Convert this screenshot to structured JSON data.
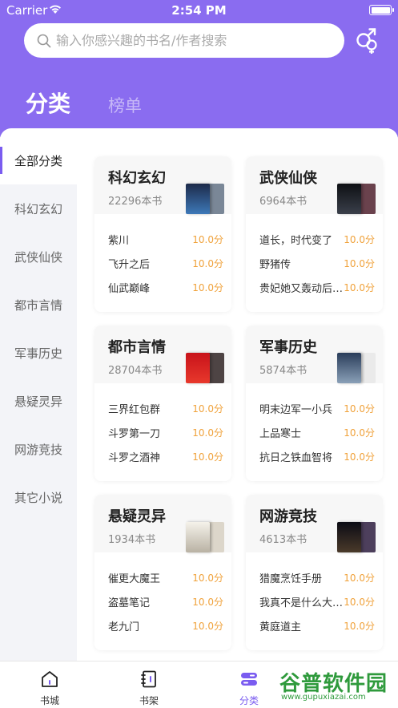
{
  "status_bar": {
    "carrier": "Carrier",
    "time": "2:54 PM"
  },
  "search": {
    "placeholder": "输入你感兴趣的书名/作者搜索"
  },
  "top_tabs": [
    {
      "label": "分类",
      "active": true
    },
    {
      "label": "榜单",
      "active": false
    }
  ],
  "sidebar": {
    "items": [
      {
        "label": "全部分类",
        "active": true
      },
      {
        "label": "科幻玄幻"
      },
      {
        "label": "武侠仙侠"
      },
      {
        "label": "都市言情"
      },
      {
        "label": "军事历史"
      },
      {
        "label": "悬疑灵异"
      },
      {
        "label": "网游竞技"
      },
      {
        "label": "其它小说"
      }
    ]
  },
  "categories": [
    {
      "title": "科幻玄幻",
      "count": "22296本书",
      "books": [
        {
          "name": "紫川",
          "score": "10.0分"
        },
        {
          "name": "飞升之后",
          "score": "10.0分"
        },
        {
          "name": "仙武巅峰",
          "score": "10.0分"
        }
      ]
    },
    {
      "title": "武侠仙侠",
      "count": "6964本书",
      "books": [
        {
          "name": "道长，时代变了",
          "score": "10.0分"
        },
        {
          "name": "野猪传",
          "score": "10.0分"
        },
        {
          "name": "贵妃她又轰动后…",
          "score": "10.0分"
        }
      ]
    },
    {
      "title": "都市言情",
      "count": "28704本书",
      "books": [
        {
          "name": "三界红包群",
          "score": "10.0分"
        },
        {
          "name": "斗罗第一刀",
          "score": "10.0分"
        },
        {
          "name": "斗罗之酒神",
          "score": "10.0分"
        }
      ]
    },
    {
      "title": "军事历史",
      "count": "5874本书",
      "books": [
        {
          "name": "明末边军一小兵",
          "score": "10.0分"
        },
        {
          "name": "上品寒士",
          "score": "10.0分"
        },
        {
          "name": "抗日之铁血智将",
          "score": "10.0分"
        }
      ]
    },
    {
      "title": "悬疑灵异",
      "count": "1934本书",
      "books": [
        {
          "name": "催更大魔王",
          "score": "10.0分"
        },
        {
          "name": "盗墓笔记",
          "score": "10.0分"
        },
        {
          "name": "老九门",
          "score": "10.0分"
        }
      ]
    },
    {
      "title": "网游竞技",
      "count": "4613本书",
      "books": [
        {
          "name": "猎魔烹饪手册",
          "score": "10.0分"
        },
        {
          "name": "我真不是什么大…",
          "score": "10.0分"
        },
        {
          "name": "黄庭道主",
          "score": "10.0分"
        }
      ]
    }
  ],
  "bottom_nav": [
    {
      "label": "书城",
      "icon": "home-icon",
      "active": false
    },
    {
      "label": "书架",
      "icon": "bookshelf-icon",
      "active": false
    },
    {
      "label": "分类",
      "icon": "category-icon",
      "active": true
    }
  ],
  "watermark": {
    "main": "谷普软件园",
    "url": "www.gupuxiazai.com"
  },
  "colors": {
    "accent": "#8a6cf0",
    "score": "#f0a23b",
    "sidebar_bg": "#f3f4f8"
  }
}
